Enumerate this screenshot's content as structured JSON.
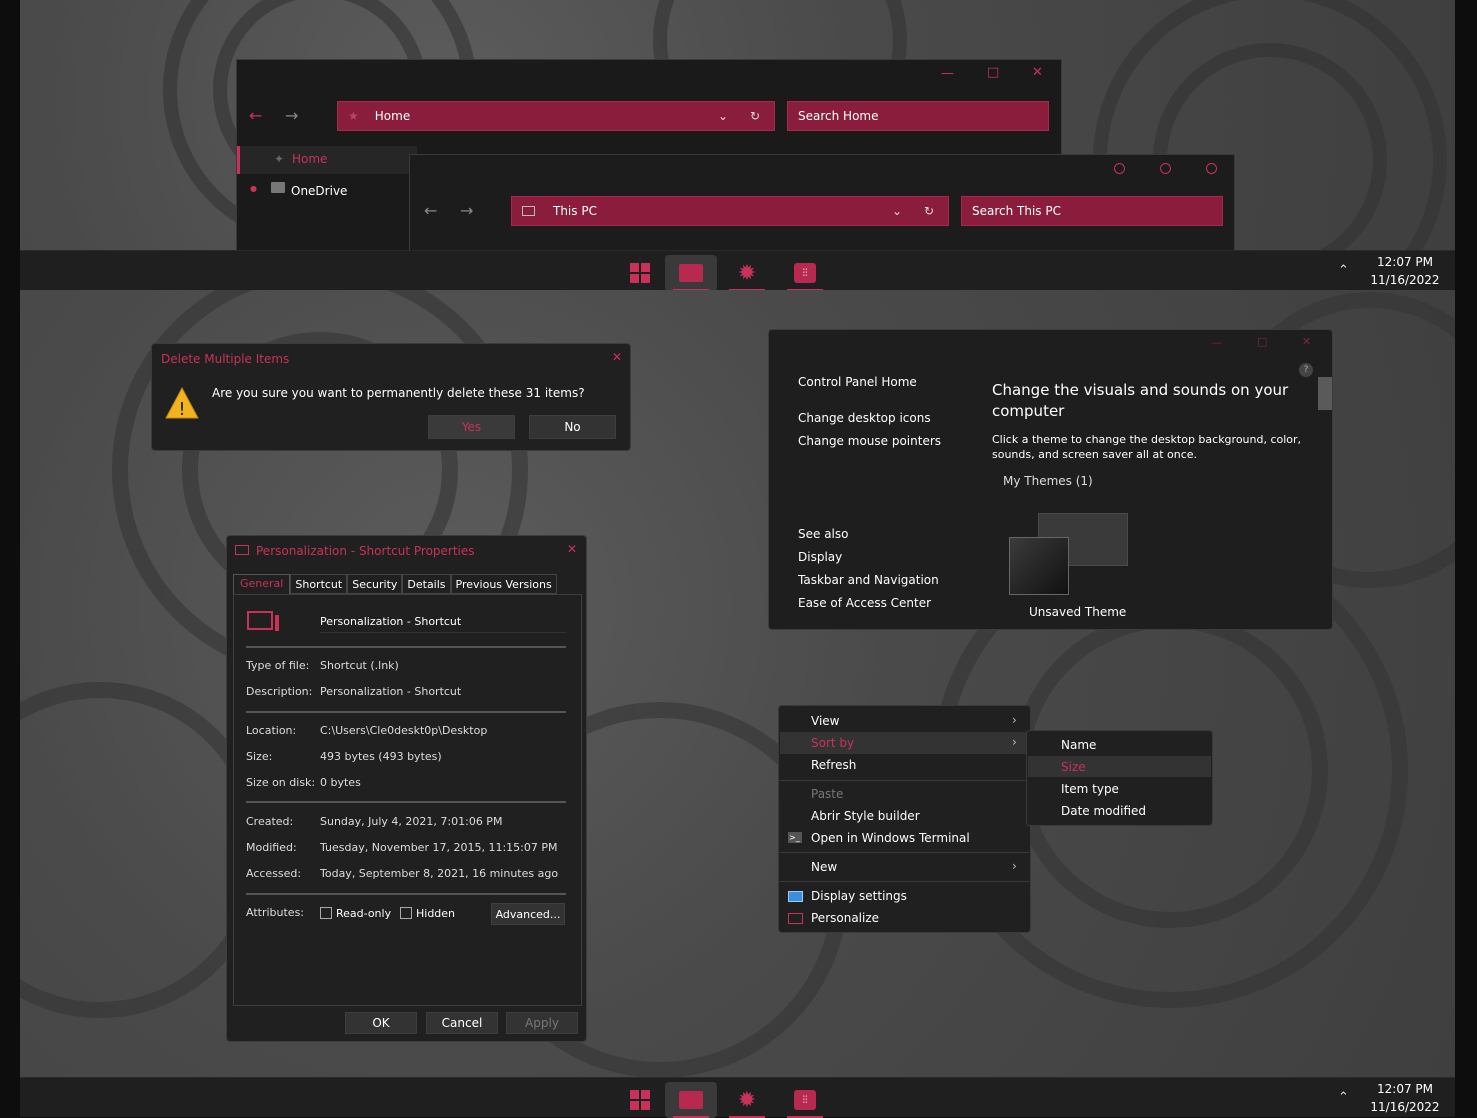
{
  "top_explorer": {
    "nav_back": "←",
    "nav_forward": "→",
    "address": "Home",
    "search": "Search Home",
    "sidebar_home": "Home",
    "sidebar_onedrive": "OneDrive",
    "min": "—",
    "max": "□",
    "close": "✕"
  },
  "second_explorer": {
    "address": "This PC",
    "search": "Search This PC",
    "nav_back": "←",
    "nav_forward": "→"
  },
  "taskbar": {
    "time": "12:07 PM",
    "date": "11/16/2022",
    "tray_chevron": "⌃"
  },
  "delete_dialog": {
    "title": "Delete Multiple Items",
    "close": "✕",
    "message": "Are you sure you want to permanently delete these 31 items?",
    "yes": "Yes",
    "no": "No"
  },
  "properties": {
    "title": "Personalization - Shortcut Properties",
    "close": "✕",
    "tabs": [
      "General",
      "Shortcut",
      "Security",
      "Details",
      "Previous Versions"
    ],
    "name": "Personalization - Shortcut",
    "rows": [
      {
        "label": "Type of file:",
        "value": "Shortcut (.lnk)"
      },
      {
        "label": "Description:",
        "value": "Personalization - Shortcut"
      },
      {
        "label": "Location:",
        "value": "C:\\Users\\Cle0deskt0p\\Desktop"
      },
      {
        "label": "Size:",
        "value": "493 bytes (493 bytes)"
      },
      {
        "label": "Size on disk:",
        "value": "0 bytes"
      },
      {
        "label": "Created:",
        "value": "Sunday, July 4, 2021, 7:01:06 PM"
      },
      {
        "label": "Modified:",
        "value": "Tuesday, November 17, 2015, 11:15:07 PM"
      },
      {
        "label": "Accessed:",
        "value": "Today, September 8, 2021, 16 minutes ago"
      }
    ],
    "attributes_label": "Attributes:",
    "readonly": "Read-only",
    "hidden": "Hidden",
    "advanced": "Advanced...",
    "ok": "OK",
    "cancel": "Cancel",
    "apply": "Apply"
  },
  "control_panel": {
    "left_home": "Control Panel Home",
    "left_links": [
      "Change desktop icons",
      "Change mouse pointers"
    ],
    "see_also": "See also",
    "see_also_links": [
      "Display",
      "Taskbar and Navigation",
      "Ease of Access Center"
    ],
    "heading": "Change the visuals and sounds on your computer",
    "description": "Click a theme to change the desktop background, color, sounds, and screen saver all at once.",
    "my_themes": "My Themes (1)",
    "theme_name": "Unsaved Theme",
    "help": "?",
    "min": "—",
    "max": "□",
    "close": "✕"
  },
  "context_menu": {
    "items": [
      {
        "label": "View",
        "submenu": true
      },
      {
        "label": "Sort by",
        "submenu": true,
        "highlight": true
      },
      {
        "label": "Refresh"
      },
      {
        "label": "Paste",
        "disabled": true
      },
      {
        "label": "Abrir Style builder"
      },
      {
        "label": "Open in Windows Terminal"
      },
      {
        "label": "New",
        "submenu": true
      },
      {
        "label": "Display settings"
      },
      {
        "label": "Personalize"
      }
    ],
    "sort_submenu": [
      "Name",
      "Size",
      "Item type",
      "Date modified"
    ]
  },
  "accent": "#c8325a"
}
